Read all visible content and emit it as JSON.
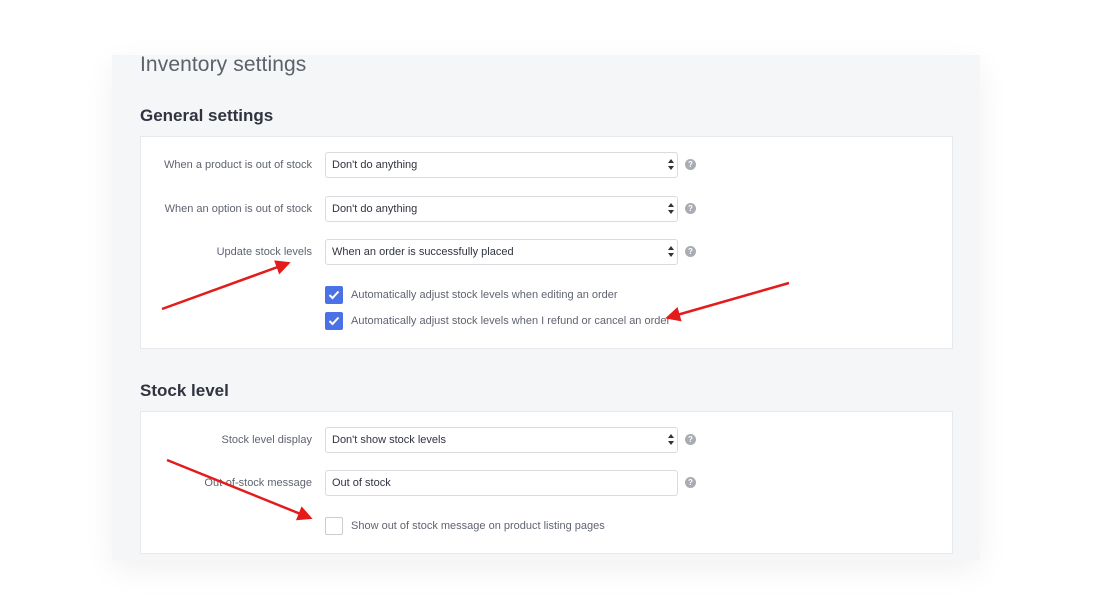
{
  "page": {
    "title": "Inventory settings"
  },
  "general_settings": {
    "title": "General settings",
    "rows": [
      {
        "label": "When a product is out of stock",
        "value": "Don't do anything",
        "type": "select"
      },
      {
        "label": "When an option is out of stock",
        "value": "Don't do anything",
        "type": "select"
      },
      {
        "label": "Update stock levels",
        "value": "When an order is successfully placed",
        "type": "select"
      }
    ],
    "checkboxes": [
      {
        "label": "Automatically adjust stock levels when editing an order",
        "checked": true
      },
      {
        "label": "Automatically adjust stock levels when I refund or cancel an order",
        "checked": true
      }
    ]
  },
  "stock_level": {
    "title": "Stock level",
    "rows": [
      {
        "label": "Stock level display",
        "value": "Don't show stock levels",
        "type": "select"
      },
      {
        "label": "Out-of-stock message",
        "value": "Out of stock",
        "type": "text"
      }
    ],
    "checkboxes": [
      {
        "label": "Show out of stock message on product listing pages",
        "checked": false
      }
    ]
  },
  "help_glyph": "?",
  "colors": {
    "accent": "#4b71e6",
    "annotation_arrow": "#e31b1b",
    "panel_bg": "#f5f6f8"
  }
}
